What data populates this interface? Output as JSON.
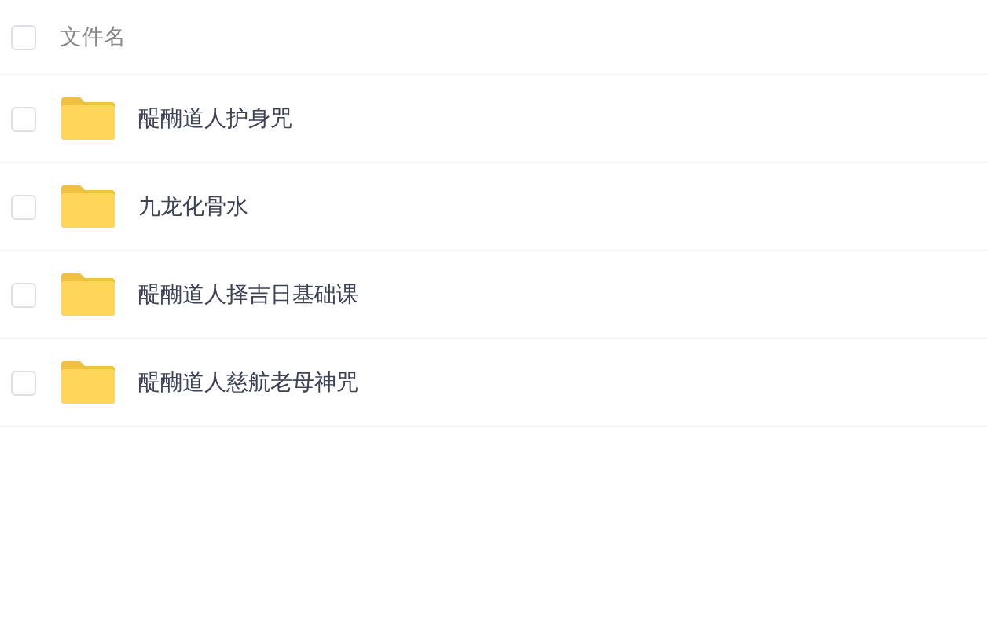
{
  "header": {
    "label": "文件名",
    "checked": false
  },
  "files": [
    {
      "name": "醍醐道人护身咒",
      "checked": false
    },
    {
      "name": "九龙化骨水",
      "checked": false
    },
    {
      "name": "醍醐道人择吉日基础课",
      "checked": false
    },
    {
      "name": "醍醐道人慈航老母神咒",
      "checked": false
    }
  ]
}
